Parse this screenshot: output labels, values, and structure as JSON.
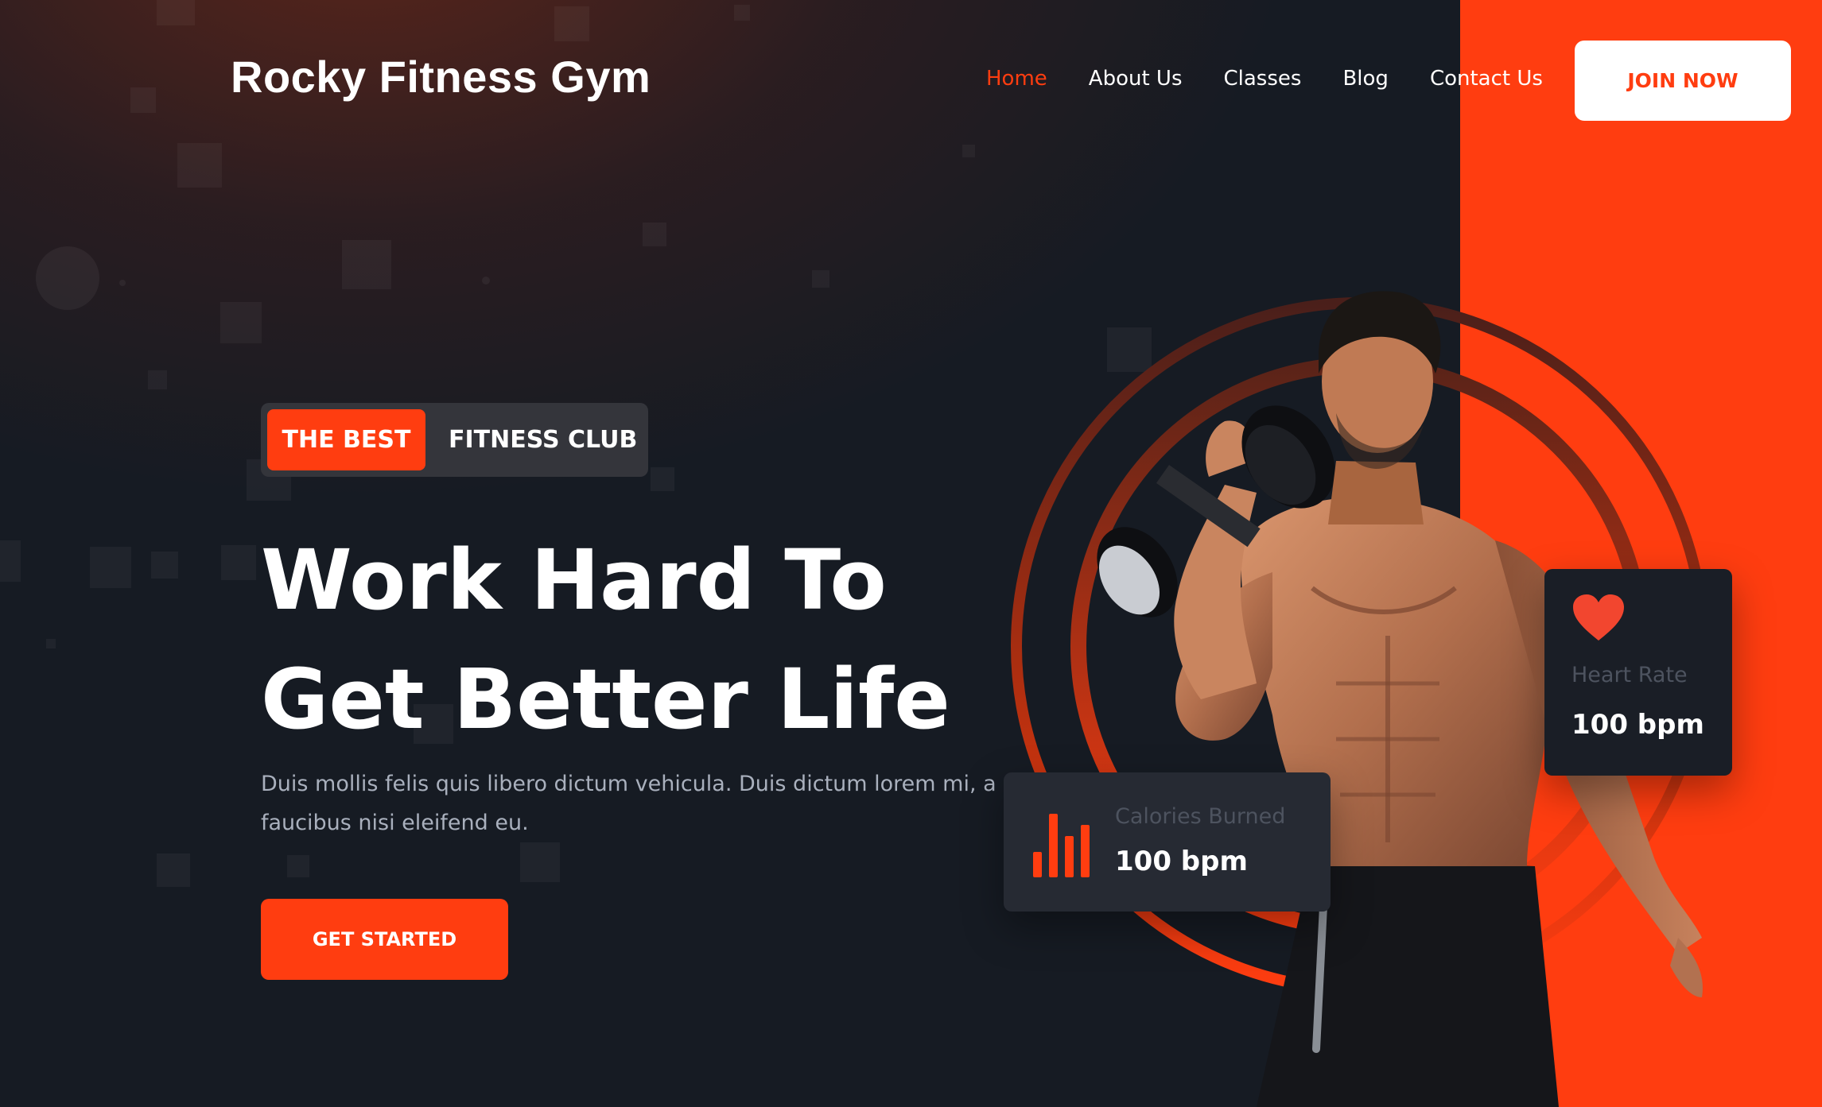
{
  "brand": {
    "name": "Rocky Fitness Gym"
  },
  "nav": {
    "items": [
      {
        "label": "Home",
        "active": true
      },
      {
        "label": "About Us",
        "active": false
      },
      {
        "label": "Classes",
        "active": false
      },
      {
        "label": "Blog",
        "active": false
      },
      {
        "label": "Contact Us",
        "active": false
      }
    ],
    "join_label": "JOIN NOW"
  },
  "hero": {
    "badge_highlight": "THE BEST",
    "badge_text": "FITNESS CLUB",
    "headline_line1": "Work Hard To",
    "headline_line2": "Get Better Life",
    "description": "Duis mollis felis quis libero dictum vehicula. Duis dictum lorem mi, a faucibus nisi eleifend eu.",
    "cta_label": "GET STARTED"
  },
  "stats": {
    "heart_rate": {
      "label": "Heart Rate",
      "value": "100 bpm",
      "icon": "heart-icon"
    },
    "calories": {
      "label": "Calories Burned",
      "value": "100 bpm",
      "icon": "bar-chart-icon"
    }
  },
  "colors": {
    "accent": "#ff3d10",
    "background": "#161b23",
    "card_dark": "#1a1e26",
    "card_gray": "#262a33",
    "muted_text": "#a9b0bd"
  }
}
